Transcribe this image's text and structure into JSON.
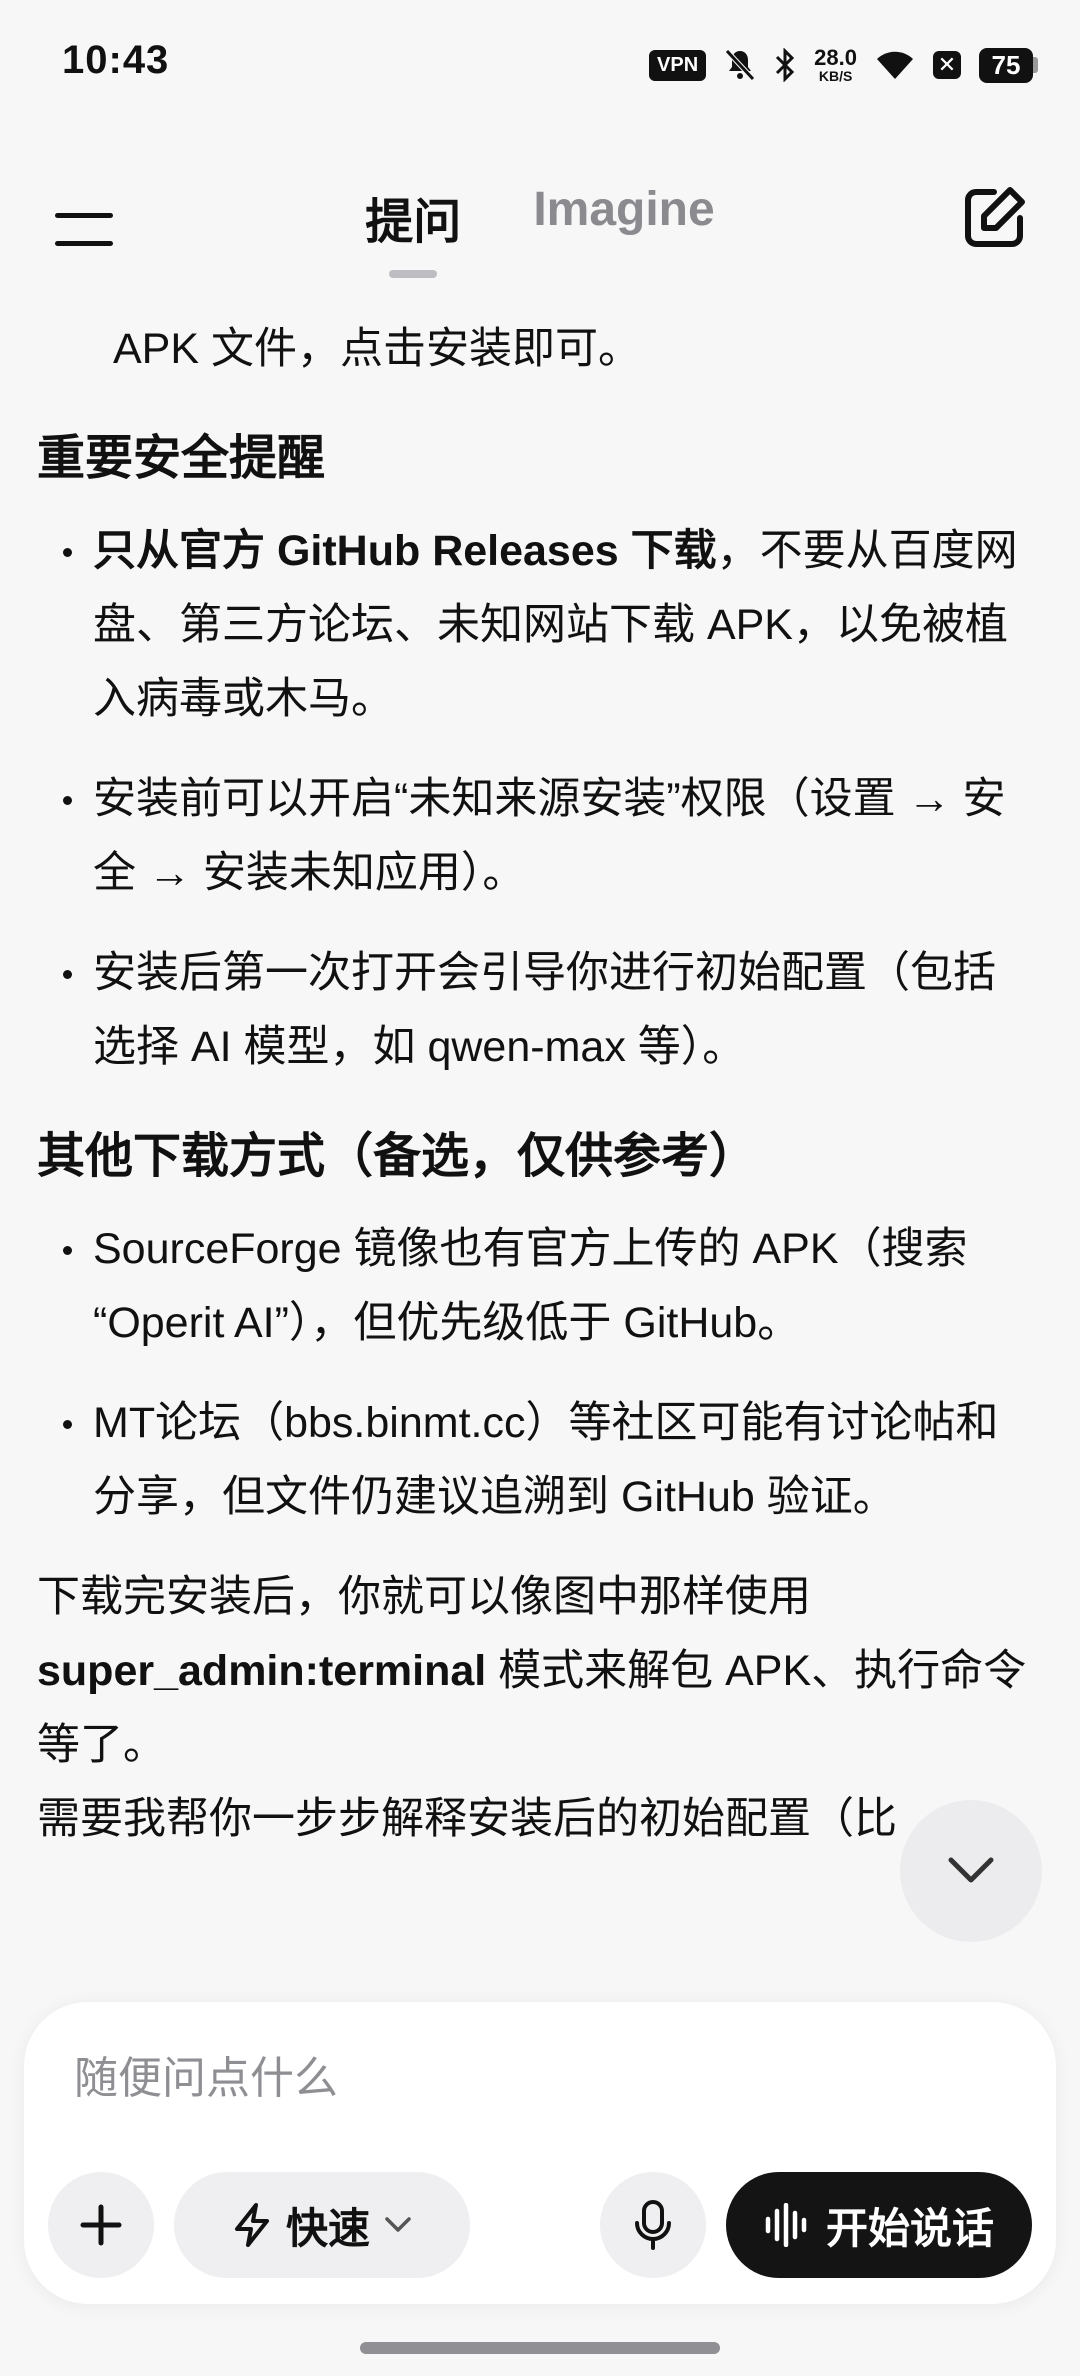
{
  "status_bar": {
    "time": "10:43",
    "vpn": "VPN",
    "net_speed_value": "28.0",
    "net_speed_unit": "KB/S",
    "battery": "75"
  },
  "header": {
    "tabs": [
      {
        "label": "提问",
        "active": true
      },
      {
        "label": "Imagine",
        "active": false
      }
    ]
  },
  "content": {
    "continued_line": "APK 文件，点击安装即可。",
    "section1": {
      "heading": "重要安全提醒",
      "items": [
        {
          "bold": "只从官方 GitHub Releases 下载",
          "text": "，不要从百度网盘、第三方论坛、未知网站下载 APK，以免被植入病毒或木马。"
        },
        {
          "bold": "",
          "text": "安装前可以开启“未知来源安装”权限（设置 → 安全 → 安装未知应用）。"
        },
        {
          "bold": "",
          "text": "安装后第一次打开会引导你进行初始配置（包括选择 AI 模型，如 qwen-max 等）。"
        }
      ]
    },
    "section2": {
      "heading": "其他下载方式（备选，仅供参考）",
      "items": [
        {
          "bold": "",
          "text": "SourceForge 镜像也有官方上传的 APK（搜索 “Operit AI”），但优先级低于 GitHub。"
        },
        {
          "bold": "",
          "text": "MT论坛（bbs.binmt.cc）等社区可能有讨论帖和分享，但文件仍建议追溯到 GitHub 验证。"
        }
      ]
    },
    "closing": {
      "before": "下载完安装后，你就可以像图中那样使用 ",
      "bold": "super_admin:terminal",
      "after": " 模式来解包 APK、执行命令等了。"
    },
    "truncated": "需要我帮你一步步解释安装后的初始配置（比"
  },
  "composer": {
    "placeholder": "随便问点什么",
    "mode_label": "快速",
    "voice_label": "开始说话"
  },
  "icons": {
    "menu": "menu-icon",
    "compose": "compose-icon",
    "scroll_down": "chevron-down-icon",
    "add": "plus-icon",
    "mode": "lightning-icon",
    "mic": "microphone-icon",
    "voice": "waveform-icon"
  }
}
